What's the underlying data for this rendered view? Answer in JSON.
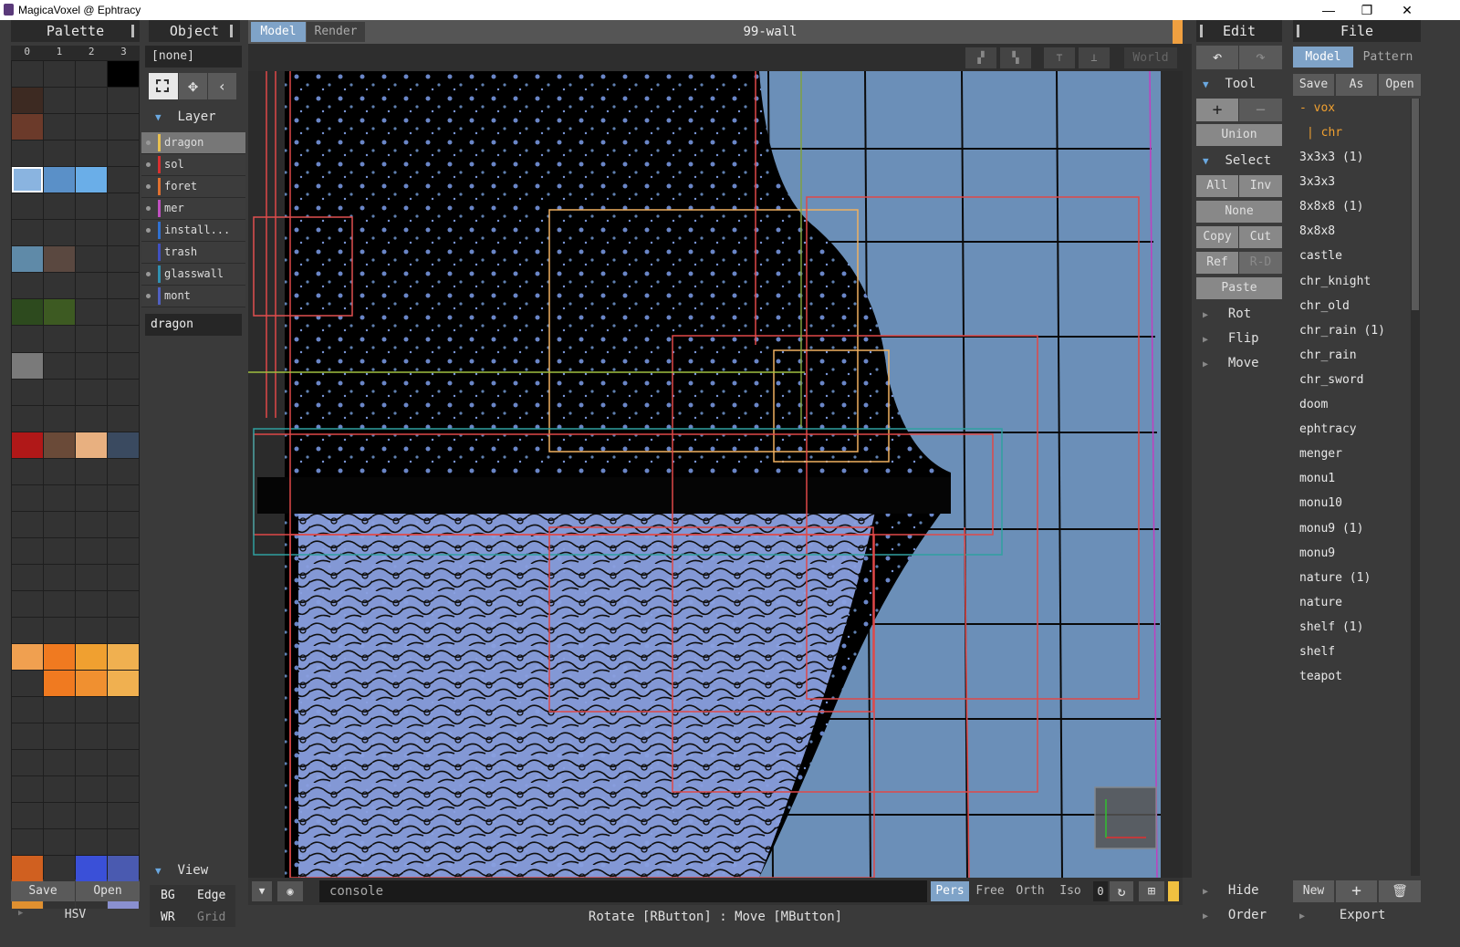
{
  "window": {
    "title": "MagicaVoxel @ Ephtracy",
    "minimize": "—",
    "restore": "❐",
    "close": "✕"
  },
  "palette": {
    "header": "Palette",
    "columns": [
      "0",
      "1",
      "2",
      "3"
    ],
    "save": "Save",
    "open": "Open",
    "hsv": "HSV",
    "swatches": [
      {
        "row": 0,
        "col": 3,
        "color": "#000000"
      },
      {
        "row": 1,
        "col": 0,
        "color": "#3d2a22"
      },
      {
        "row": 2,
        "col": 0,
        "color": "#6b3a2a"
      },
      {
        "row": 4,
        "col": 0,
        "color": "#8ab4e0"
      },
      {
        "row": 4,
        "col": 1,
        "color": "#5a90c8"
      },
      {
        "row": 4,
        "col": 2,
        "color": "#6aaee8"
      },
      {
        "row": 7,
        "col": 0,
        "color": "#5f8aa8"
      },
      {
        "row": 7,
        "col": 1,
        "color": "#5a4840"
      },
      {
        "row": 9,
        "col": 0,
        "color": "#2d4a1e"
      },
      {
        "row": 9,
        "col": 1,
        "color": "#3d5a22"
      },
      {
        "row": 11,
        "col": 0,
        "color": "#7a7a7a"
      },
      {
        "row": 14,
        "col": 0,
        "color": "#b01818"
      },
      {
        "row": 14,
        "col": 1,
        "color": "#6a4a38"
      },
      {
        "row": 14,
        "col": 2,
        "color": "#e8b080"
      },
      {
        "row": 14,
        "col": 3,
        "color": "#3a4a60"
      },
      {
        "row": 22,
        "col": 0,
        "color": "#f0a050"
      },
      {
        "row": 22,
        "col": 1,
        "color": "#f07a20"
      },
      {
        "row": 22,
        "col": 2,
        "color": "#f0a030"
      },
      {
        "row": 22,
        "col": 3,
        "color": "#f0b050"
      },
      {
        "row": 23,
        "col": 1,
        "color": "#f07a20"
      },
      {
        "row": 23,
        "col": 2,
        "color": "#f09030"
      },
      {
        "row": 23,
        "col": 3,
        "color": "#f0b050"
      },
      {
        "row": 30,
        "col": 0,
        "color": "#d06020"
      },
      {
        "row": 30,
        "col": 2,
        "color": "#3a50d8"
      },
      {
        "row": 30,
        "col": 3,
        "color": "#4a5ab0"
      },
      {
        "row": 31,
        "col": 0,
        "color": "#e09030"
      },
      {
        "row": 31,
        "col": 3,
        "color": "#f8d8b0"
      },
      {
        "row": 31,
        "col": 3,
        "color": "#8a90d0"
      }
    ]
  },
  "object": {
    "header": "Object",
    "selection": "[none]",
    "layer_header": "Layer",
    "layers": [
      {
        "name": "dragon",
        "color": "#e8c050",
        "active": true,
        "dot": true
      },
      {
        "name": "sol",
        "color": "#d83030",
        "active": false,
        "dot": true
      },
      {
        "name": "foret",
        "color": "#e07030",
        "active": false,
        "dot": true
      },
      {
        "name": "mer",
        "color": "#c050c0",
        "active": false,
        "dot": true
      },
      {
        "name": "install...",
        "color": "#3070d0",
        "active": false,
        "dot": true
      },
      {
        "name": "trash",
        "color": "#4050c0",
        "active": false,
        "dot": false
      },
      {
        "name": "glasswall",
        "color": "#3090b0",
        "active": false,
        "dot": true
      },
      {
        "name": "mont",
        "color": "#5060c0",
        "active": false,
        "dot": true
      }
    ],
    "current_name": "dragon",
    "view_header": "View",
    "view_buttons": [
      [
        "BG",
        "Edge"
      ],
      [
        "WR",
        "Grid"
      ]
    ]
  },
  "tabs": {
    "model": "Model",
    "render": "Render",
    "file_title": "99-wall"
  },
  "viewport": {
    "world_label": "World",
    "console_placeholder": "console",
    "cam_modes": [
      "Pers",
      "Free",
      "Orth",
      "Iso"
    ],
    "zoom_value": "0",
    "status": "Rotate [RButton] : Move [MButton]",
    "accent": "#f0a040"
  },
  "edit": {
    "header": "Edit",
    "tool_header": "Tool",
    "union": "Union",
    "select_header": "Select",
    "all": "All",
    "inv": "Inv",
    "none": "None",
    "copy": "Copy",
    "cut": "Cut",
    "ref": "Ref",
    "rd": "R-D",
    "paste": "Paste",
    "rot": "Rot",
    "flip": "Flip",
    "move": "Move",
    "hide": "Hide",
    "order": "Order"
  },
  "file": {
    "header": "File",
    "tab_model": "Model",
    "tab_pattern": "Pattern",
    "save": "Save",
    "as": "As",
    "open": "Open",
    "folder_vox": "- vox",
    "folder_chr": "| chr",
    "items": [
      "3x3x3 (1)",
      "3x3x3",
      "8x8x8 (1)",
      "8x8x8",
      "castle",
      "chr_knight",
      "chr_old",
      "chr_rain (1)",
      "chr_rain",
      "chr_sword",
      "doom",
      "ephtracy",
      "menger",
      "monu1",
      "monu10",
      "monu9 (1)",
      "monu9",
      "nature (1)",
      "nature",
      "shelf (1)",
      "shelf",
      "teapot"
    ],
    "new": "New",
    "export": "Export"
  }
}
